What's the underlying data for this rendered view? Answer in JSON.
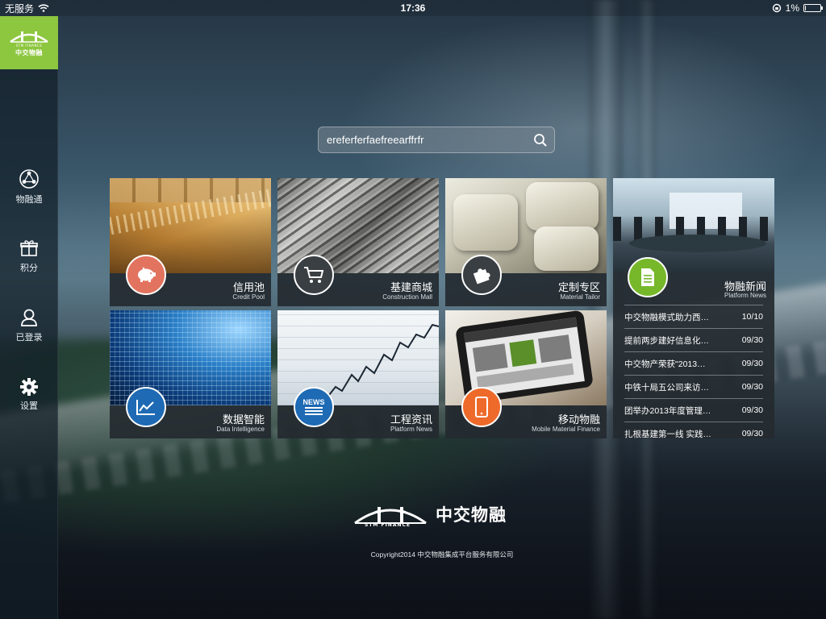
{
  "status": {
    "carrier": "无服务",
    "time": "17:36",
    "battery": "1%",
    "battery_level": 0.01
  },
  "sidebar": {
    "logo": {
      "text": "中交物融",
      "sub": "STM FINANCE",
      "bg": "#8dc63f"
    },
    "items": [
      {
        "label": "物融通",
        "icon": "network-icon"
      },
      {
        "label": "积分",
        "icon": "gift-icon"
      },
      {
        "label": "已登录",
        "icon": "user-icon"
      },
      {
        "label": "设置",
        "icon": "gear-icon"
      }
    ]
  },
  "search": {
    "value": "ereferferfaefreearffrfr"
  },
  "tiles": [
    {
      "cn": "信用池",
      "en": "Credit Pool",
      "icon": "piggy-bank-icon",
      "color": "#e2735f"
    },
    {
      "cn": "基建商城",
      "en": "Construction Mall",
      "icon": "cart-icon",
      "color": "#3a3f44"
    },
    {
      "cn": "定制专区",
      "en": "Material Tailor",
      "icon": "puzzle-icon",
      "color": "#3a3f44"
    },
    {
      "cn": "数据智能",
      "en": "Data Intelligence",
      "icon": "chart-icon",
      "color": "#1e6ab4"
    },
    {
      "cn": "工程资讯",
      "en": "Platform News",
      "icon": "news-icon",
      "color": "#1e6ab4"
    },
    {
      "cn": "移动物融",
      "en": "Mobile Material Finance",
      "icon": "tablet-icon",
      "color": "#ee6a2a"
    }
  ],
  "news": {
    "cn": "物融新闻",
    "en": "Platform News",
    "icon": "document-icon",
    "color": "#76b82a",
    "items": [
      {
        "title": "中交物融模式助力西…",
        "date": "10/10"
      },
      {
        "title": "提前两步建好信息化…",
        "date": "09/30"
      },
      {
        "title": "中交物产荣获\"2013…",
        "date": "09/30"
      },
      {
        "title": "中铁十局五公司来访…",
        "date": "09/30"
      },
      {
        "title": "团举办2013年度管理…",
        "date": "09/30"
      },
      {
        "title": "扎根基建第一线 实践…",
        "date": "09/30"
      }
    ]
  },
  "footer": {
    "brand_cn": "中交物融",
    "brand_en": "STM FINANCE",
    "copyright": "Copyright2014 中交物融集成平台服务有限公司"
  }
}
